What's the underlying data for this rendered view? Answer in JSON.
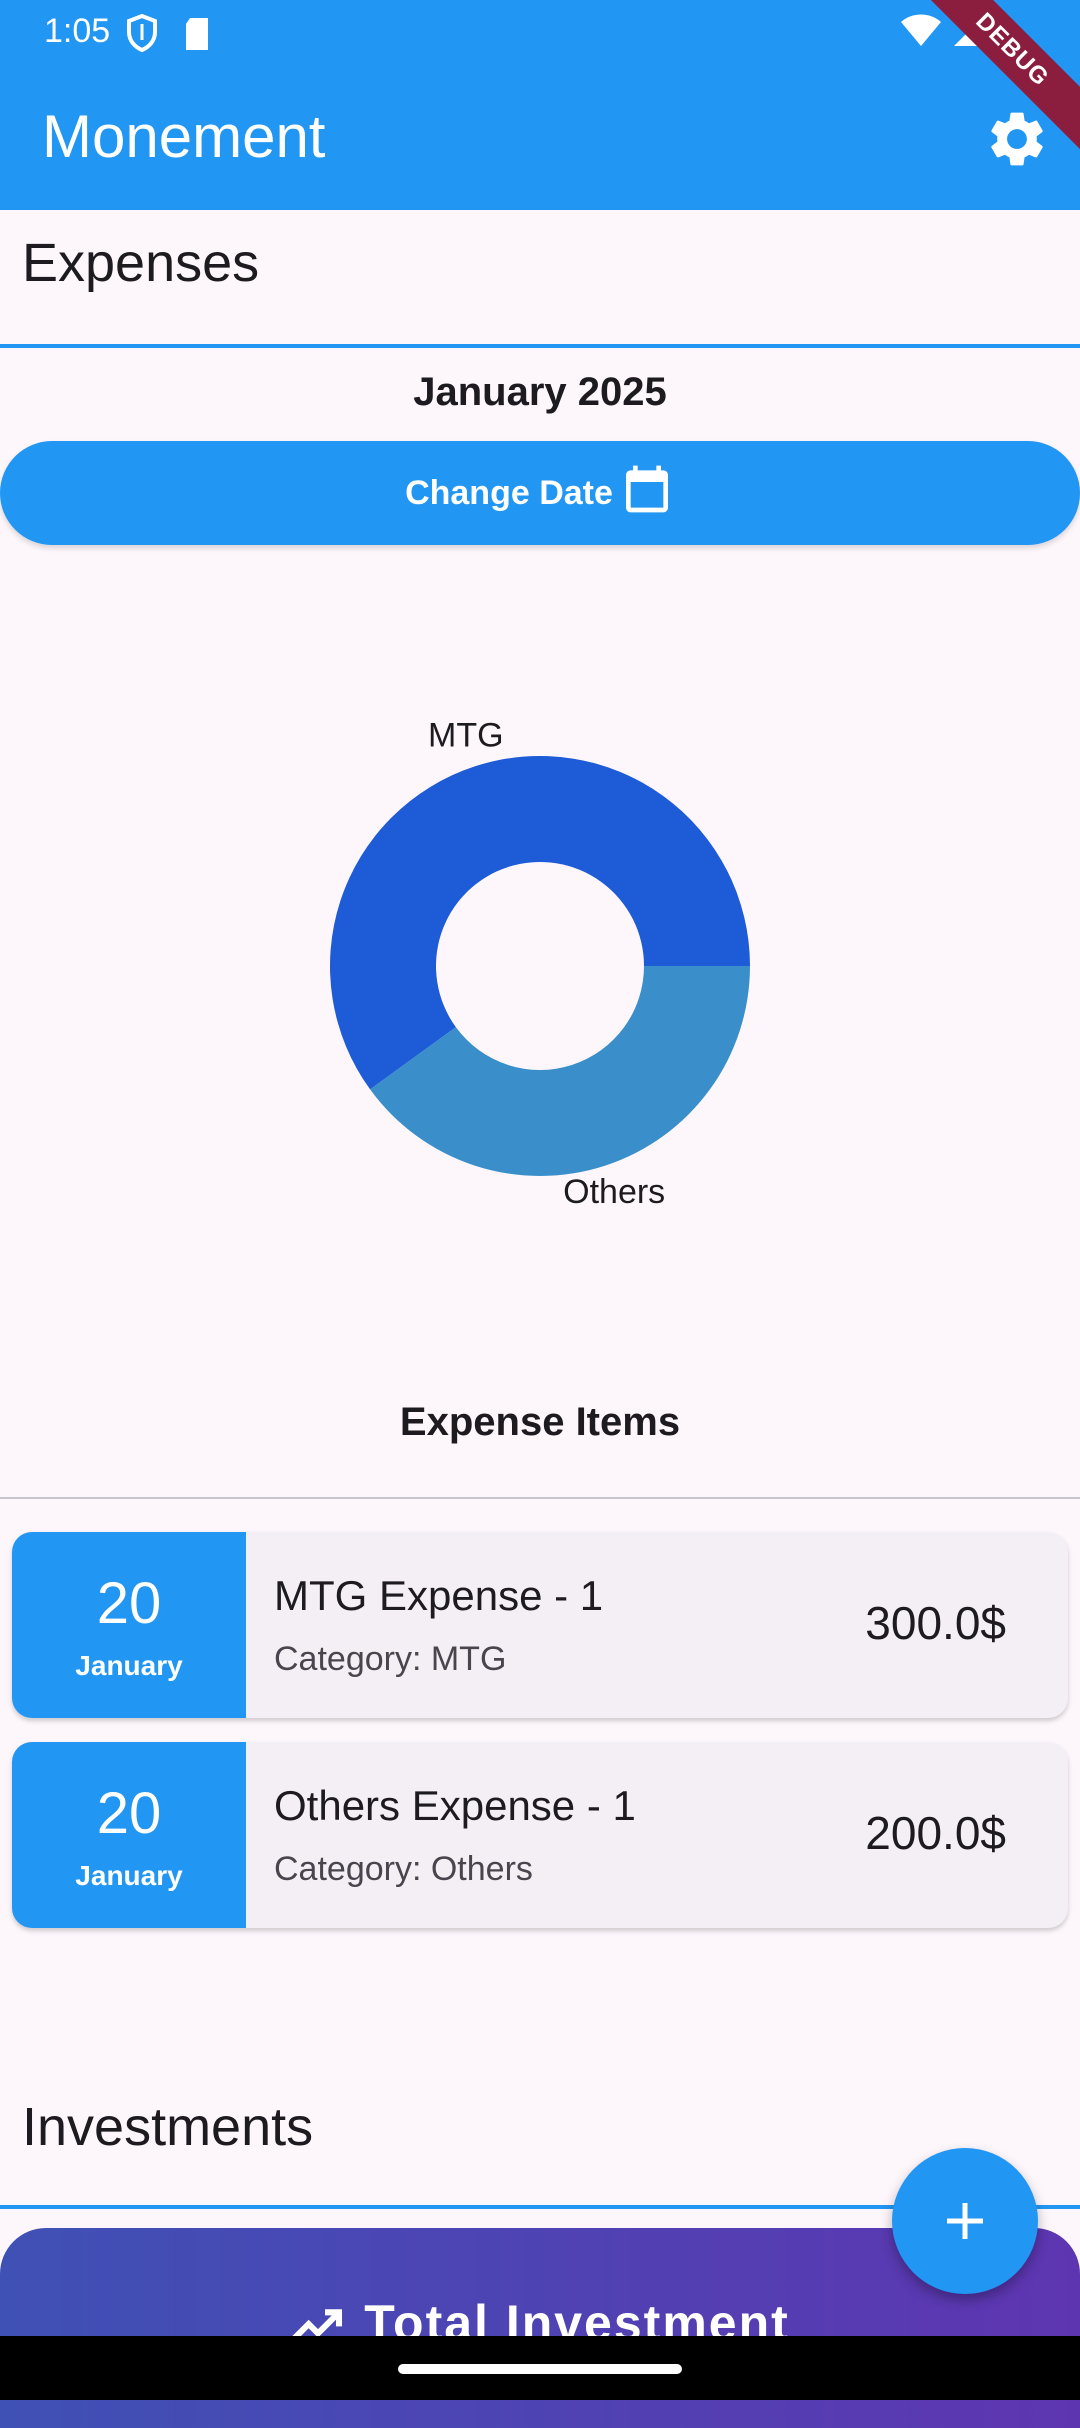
{
  "status_bar": {
    "time": "1:05",
    "icons_left": [
      "shield-icon",
      "sd-card-icon"
    ],
    "icons_right": [
      "wifi-icon",
      "signal-icon"
    ]
  },
  "app_bar": {
    "title": "Monement",
    "settings_icon": "gear-icon",
    "debug_badge": "DEBUG",
    "color": "#2196F3"
  },
  "expenses": {
    "section_title": "Expenses",
    "month_label": "January 2025",
    "change_date_label": "Change Date",
    "change_date_icon": "calendar-icon",
    "chart_data": {
      "type": "pie",
      "donut": true,
      "slices": [
        {
          "label": "MTG",
          "value": 300.0,
          "color": "#1E5BD6"
        },
        {
          "label": "Others",
          "value": 200.0,
          "color": "#3A8FCB"
        }
      ]
    },
    "items_title": "Expense Items",
    "items": [
      {
        "day": "20",
        "month": "January",
        "name": "MTG Expense - 1",
        "category": "Category: MTG",
        "amount": "300.0$"
      },
      {
        "day": "20",
        "month": "January",
        "name": "Others Expense - 1",
        "category": "Category: Others",
        "amount": "200.0$"
      }
    ]
  },
  "investments": {
    "section_title": "Investments",
    "total_label": "Total Investment",
    "trend_icon": "trending-up-icon"
  },
  "fab": {
    "icon": "plus-icon"
  }
}
